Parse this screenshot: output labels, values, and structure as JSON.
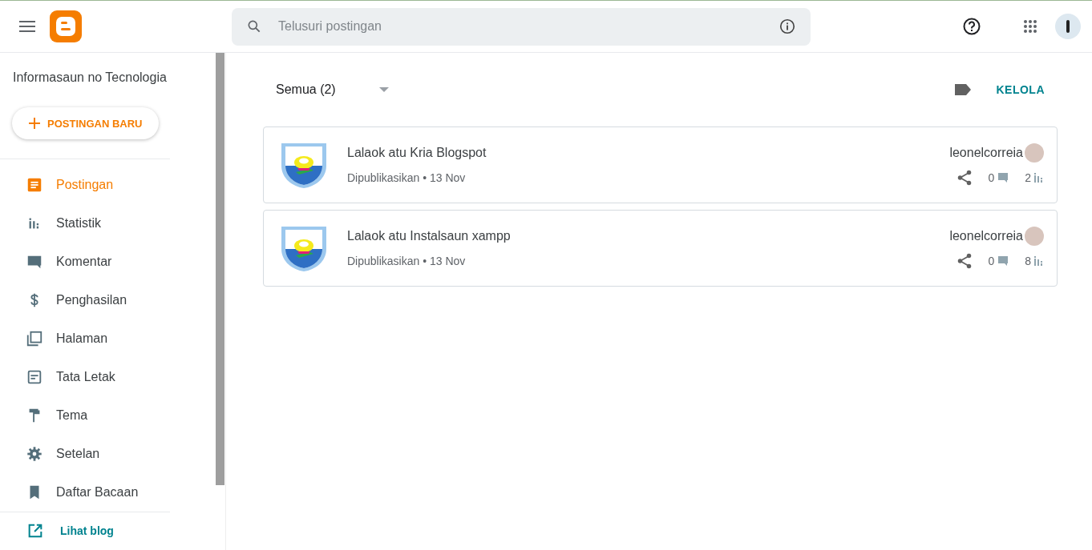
{
  "search": {
    "placeholder": "Telusuri postingan"
  },
  "sidebar": {
    "blog_name": "Informasaun no Tecnologia",
    "new_post_button": "POSTINGAN BARU",
    "items": [
      {
        "label": "Postingan",
        "selected": true
      },
      {
        "label": "Statistik",
        "selected": false
      },
      {
        "label": "Komentar",
        "selected": false
      },
      {
        "label": "Penghasilan",
        "selected": false
      },
      {
        "label": "Halaman",
        "selected": false
      },
      {
        "label": "Tata Letak",
        "selected": false
      },
      {
        "label": "Tema",
        "selected": false
      },
      {
        "label": "Setelan",
        "selected": false
      },
      {
        "label": "Daftar Bacaan",
        "selected": false
      }
    ],
    "view_blog_link": "Lihat blog"
  },
  "filter": {
    "label": "Semua (2)",
    "manage_button": "KELOLA"
  },
  "posts": [
    {
      "title": "Lalaok atu Kria Blogspot",
      "status": "Dipublikasikan • 13 Nov",
      "author": "leonelcorreia",
      "comments": "0",
      "views": "2"
    },
    {
      "title": "Lalaok atu Instalsaun xampp",
      "status": "Dipublikasikan • 13 Nov",
      "author": "leonelcorreia",
      "comments": "0",
      "views": "8"
    }
  ]
}
